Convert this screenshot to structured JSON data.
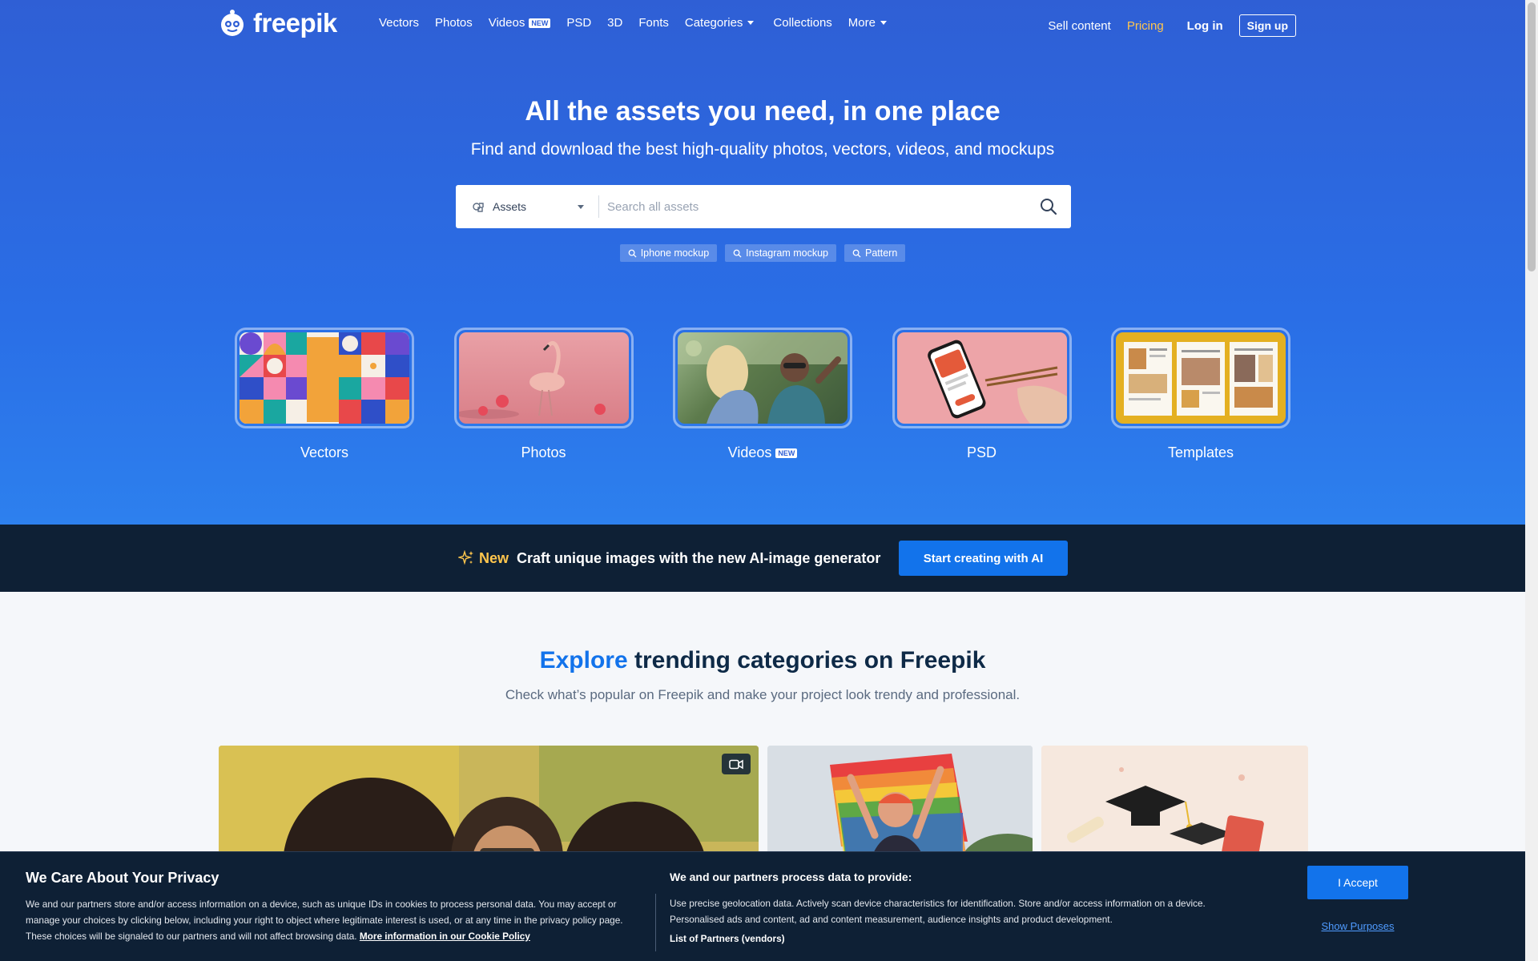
{
  "nav": {
    "logo_text": "freepik",
    "links": [
      {
        "label": "Vectors"
      },
      {
        "label": "Photos"
      },
      {
        "label": "Videos",
        "badge": "NEW"
      },
      {
        "label": "PSD"
      },
      {
        "label": "3D"
      },
      {
        "label": "Fonts"
      },
      {
        "label": "Categories",
        "dropdown": true
      },
      {
        "label": "Collections"
      },
      {
        "label": "More",
        "dropdown": true
      }
    ],
    "sell_label": "Sell content",
    "pricing_label": "Pricing",
    "login_label": "Log in",
    "signup_label": "Sign up"
  },
  "hero": {
    "title": "All the assets you need, in one place",
    "subtitle": "Find and download the best high-quality photos, vectors, videos, and mockups",
    "search": {
      "type_label": "Assets",
      "placeholder": "Search all assets"
    },
    "tags": [
      "Iphone mockup",
      "Instagram mockup",
      "Pattern"
    ],
    "categories": [
      {
        "label": "Vectors"
      },
      {
        "label": "Photos"
      },
      {
        "label": "Videos",
        "badge": "NEW"
      },
      {
        "label": "PSD"
      },
      {
        "label": "Templates"
      }
    ]
  },
  "ai_banner": {
    "new_label": "New",
    "text": "Craft unique images with the new AI-image generator",
    "button_label": "Start creating with AI"
  },
  "explore": {
    "title_accent": "Explore",
    "title_rest": " trending categories on Freepik",
    "subtitle": "Check what’s popular on Freepik and make your project look trendy and professional."
  },
  "cookie": {
    "title": "We Care About Your Privacy",
    "body": "We and our partners store and/or access information on a device, such as unique IDs in cookies to process personal data. You may accept or manage your choices by clicking below, including your right to object where legitimate interest is used, or at any time in the privacy policy page. These choices will be signaled to our partners and will not affect browsing data. ",
    "policy_link": "More information in our Cookie Policy",
    "right_title": "We and our partners process data to provide:",
    "right_body": "Use precise geolocation data. Actively scan device characteristics for identification. Store and/or access information on a device. Personalised ads and content, ad and content measurement, audience insights and product development.",
    "vendors_link": "List of Partners (vendors)",
    "accept_label": "I Accept",
    "purposes_label": "Show Purposes"
  },
  "colors": {
    "hero_blue": "#2f5fd5",
    "accent_blue": "#1273eb",
    "dark_navy": "#0e2035",
    "pricing_yellow": "#ffc64d"
  }
}
